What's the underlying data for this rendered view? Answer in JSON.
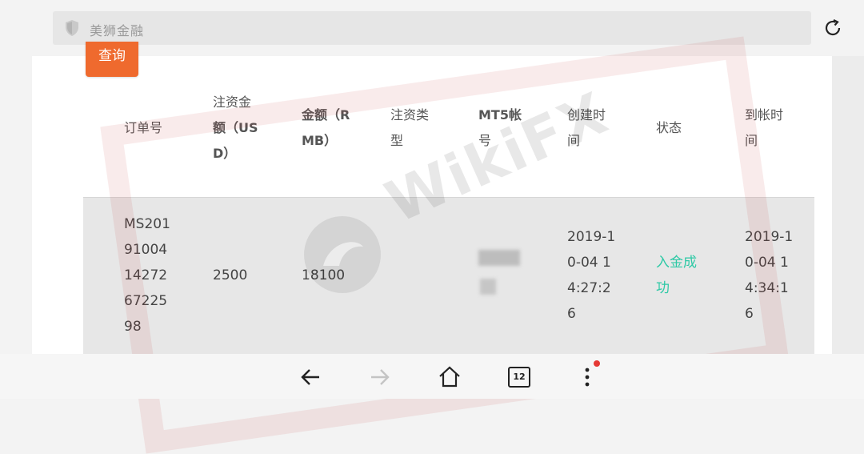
{
  "browser": {
    "address_text": "美狮金融",
    "tab_count": "12"
  },
  "page": {
    "query_label": "查询"
  },
  "table": {
    "headers": [
      [
        "订单号"
      ],
      [
        "注资金",
        "额（US",
        "D）"
      ],
      [
        "金额（R",
        "MB）"
      ],
      [
        "注资类",
        "型"
      ],
      [
        "MT5帐",
        "号"
      ],
      [
        "创建时",
        "间"
      ],
      [
        "状态"
      ],
      [
        "到帐时",
        "间"
      ]
    ],
    "row": {
      "order_no": [
        "MS201",
        "91004",
        "14272",
        "67225",
        "98"
      ],
      "amount_usd": "2500",
      "amount_rmb": "18100",
      "type": "",
      "created": [
        "2019-1",
        "0-04 1",
        "4:27:2",
        "6"
      ],
      "status": [
        "入金成",
        "功"
      ],
      "arrived": [
        "2019-1",
        "0-04 1",
        "4:34:1",
        "6"
      ]
    }
  },
  "watermark": {
    "text": "WikiFX"
  },
  "colors": {
    "accent": "#ef6a2e",
    "status_success": "#2fc9a6"
  },
  "icons": [
    "shield-icon",
    "reload-icon",
    "back-icon",
    "forward-icon",
    "home-icon",
    "tabs-icon",
    "menu-icon"
  ]
}
